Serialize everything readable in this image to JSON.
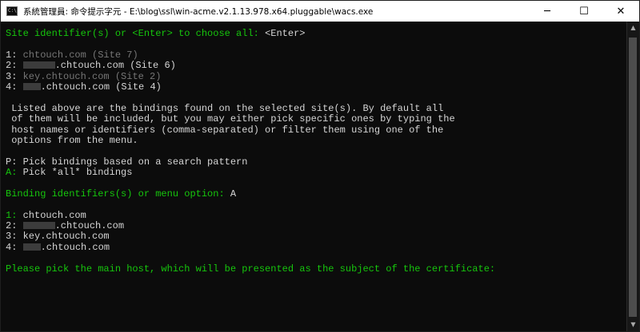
{
  "window": {
    "title": "系統管理員: 命令提示字元 - E:\\blog\\ssl\\win-acme.v2.1.13.978.x64.pluggable\\wacs.exe",
    "icon_text": "C:\\",
    "minimize_glyph": "─",
    "maximize_glyph": "☐",
    "close_glyph": "✕"
  },
  "console": {
    "prompt1_label": "Site identifier(s) or <Enter> to choose all: ",
    "prompt1_input": "<Enter>",
    "sites": [
      {
        "num": "1:",
        "host": "chtouch.com",
        "site": "(Site 7)"
      },
      {
        "num": "2:",
        "host": ".chtouch.com",
        "site": "(Site 6)"
      },
      {
        "num": "3:",
        "host": "key.chtouch.com",
        "site": "(Site 2)"
      },
      {
        "num": "4:",
        "host": ".chtouch.com",
        "site": "(Site 4)"
      }
    ],
    "info": [
      " Listed above are the bindings found on the selected site(s). By default all",
      " of them will be included, but you may either pick specific ones by typing the",
      " host names or identifiers (comma-separated) or filter them using one of the",
      " options from the menu."
    ],
    "menu": [
      {
        "key": "P:",
        "text": " Pick bindings based on a search pattern"
      },
      {
        "key": "A:",
        "text": " Pick *all* bindings"
      }
    ],
    "prompt2_label": "Binding identifiers(s) or menu option: ",
    "prompt2_input": "A",
    "bindings": [
      {
        "num": "1:",
        "host": "chtouch.com"
      },
      {
        "num": "2:",
        "host": ".chtouch.com"
      },
      {
        "num": "3:",
        "host": "key.chtouch.com"
      },
      {
        "num": "4:",
        "host": ".chtouch.com"
      }
    ],
    "final_prompt": "Please pick the main host, which will be presented as the subject of the certificate:"
  },
  "scrollbar": {
    "up_glyph": "▲",
    "down_glyph": "▼"
  },
  "colors": {
    "background": "#0c0c0c",
    "green": "#16c60c",
    "gray": "#767676",
    "text": "#cccccc"
  }
}
